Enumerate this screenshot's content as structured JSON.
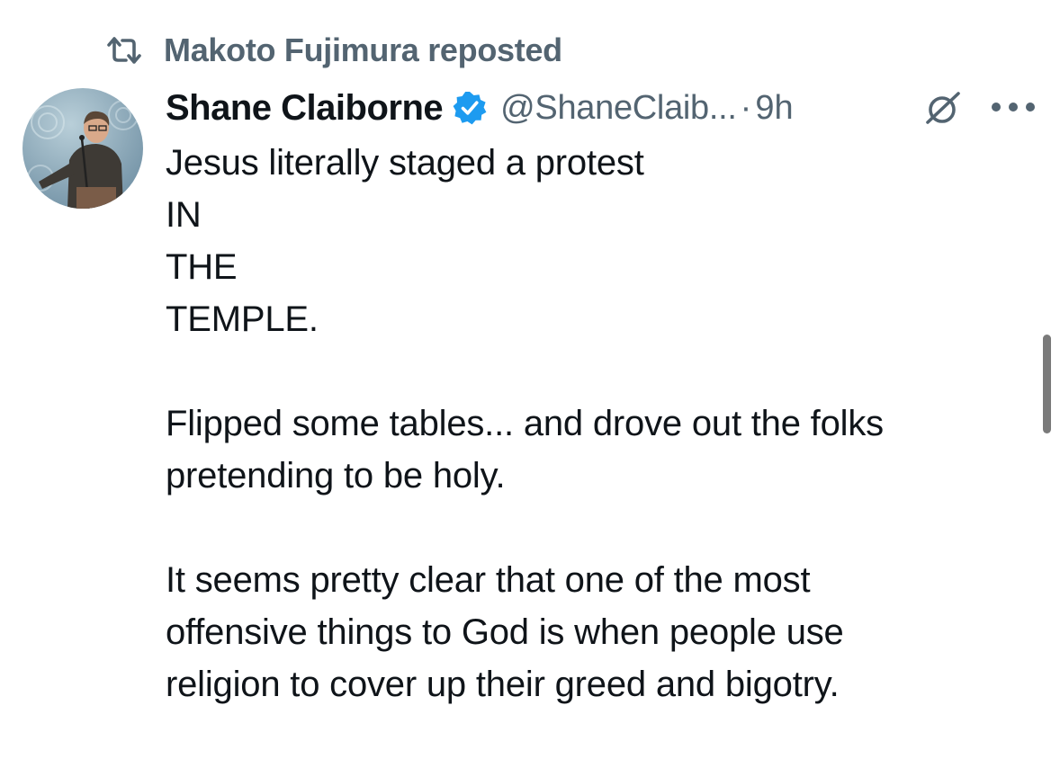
{
  "repost": {
    "icon": "repost-icon",
    "text": "Makoto Fujimura reposted"
  },
  "tweet": {
    "author": {
      "avatar": "avatar",
      "display_name": "Shane Claiborne",
      "verified_icon": "verified-badge-icon",
      "handle": "@ShaneClaib...",
      "separator": "·",
      "time": "9h"
    },
    "actions": {
      "grok_icon": "grok-icon",
      "more_icon": "more-options-icon"
    },
    "body": {
      "line_1": "Jesus literally staged a protest",
      "line_2": "IN",
      "line_3": "THE",
      "line_4": "TEMPLE.",
      "line_5": "Flipped some tables... and drove out the folks",
      "line_6": "pretending to be holy.",
      "line_7": "It seems pretty clear that one of the most",
      "line_8": "offensive things to God is when people use",
      "line_9": "religion to cover up their greed and bigotry."
    }
  },
  "colors": {
    "text_primary": "#0f1419",
    "text_secondary": "#536471",
    "verified_blue": "#1d9bf0",
    "background": "#ffffff"
  }
}
